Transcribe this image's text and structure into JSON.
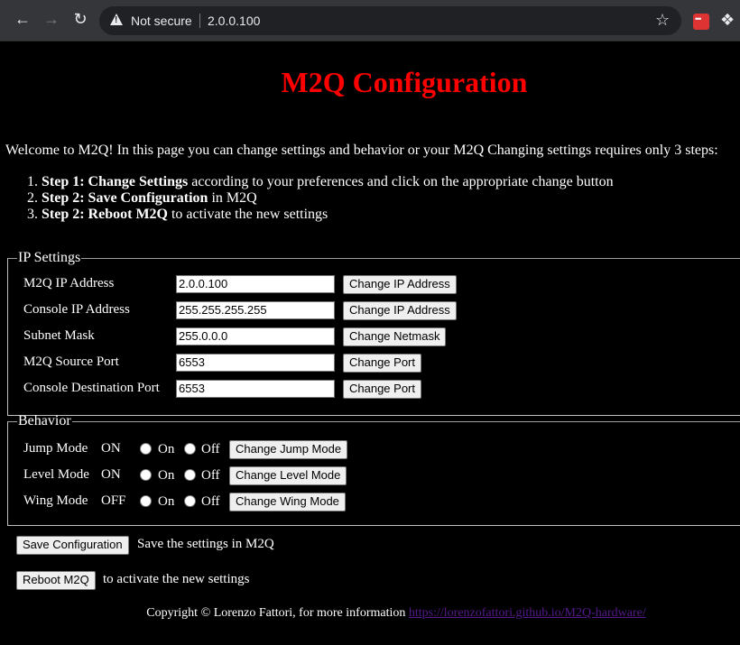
{
  "browser": {
    "security_label": "Not secure",
    "url": "2.0.0.100"
  },
  "page": {
    "title": "M2Q Configuration",
    "intro": "Welcome to M2Q! In this page you can change settings and behavior or your M2Q Changing settings requires only 3 steps:",
    "steps": [
      {
        "bold": "Step 1: Change Settings",
        "rest": " according to your preferences and click on the appropriate change button"
      },
      {
        "bold": "Step 2: Save Configuration",
        "rest": " in M2Q"
      },
      {
        "bold": "Step 2: Reboot M2Q",
        "rest": " to activate the new settings"
      }
    ]
  },
  "ip_settings": {
    "legend": "IP Settings",
    "rows": [
      {
        "label": "M2Q IP Address",
        "value": "2.0.0.100",
        "button": "Change IP Address"
      },
      {
        "label": "Console IP Address",
        "value": "255.255.255.255",
        "button": "Change IP Address"
      },
      {
        "label": "Subnet Mask",
        "value": "255.0.0.0",
        "button": "Change Netmask"
      },
      {
        "label": "M2Q Source Port",
        "value": "6553",
        "button": "Change Port"
      },
      {
        "label": "Console Destination Port",
        "value": "6553",
        "button": "Change Port"
      }
    ]
  },
  "behavior": {
    "legend": "Behavior",
    "on_label": "On",
    "off_label": "Off",
    "rows": [
      {
        "label": "Jump Mode",
        "state": "ON",
        "button": "Change Jump Mode"
      },
      {
        "label": "Level Mode",
        "state": "ON",
        "button": "Change Level Mode"
      },
      {
        "label": "Wing Mode",
        "state": "OFF",
        "button": "Change Wing Mode"
      }
    ]
  },
  "actions": {
    "save_button": "Save Configuration",
    "save_text": "Save the settings in M2Q",
    "reboot_button": "Reboot M2Q",
    "reboot_text": "to activate the new settings"
  },
  "footer": {
    "text": "Copyright © Lorenzo Fattori, for more information ",
    "link": "https://lorenzofattori.github.io/M2Q-hardware/"
  }
}
